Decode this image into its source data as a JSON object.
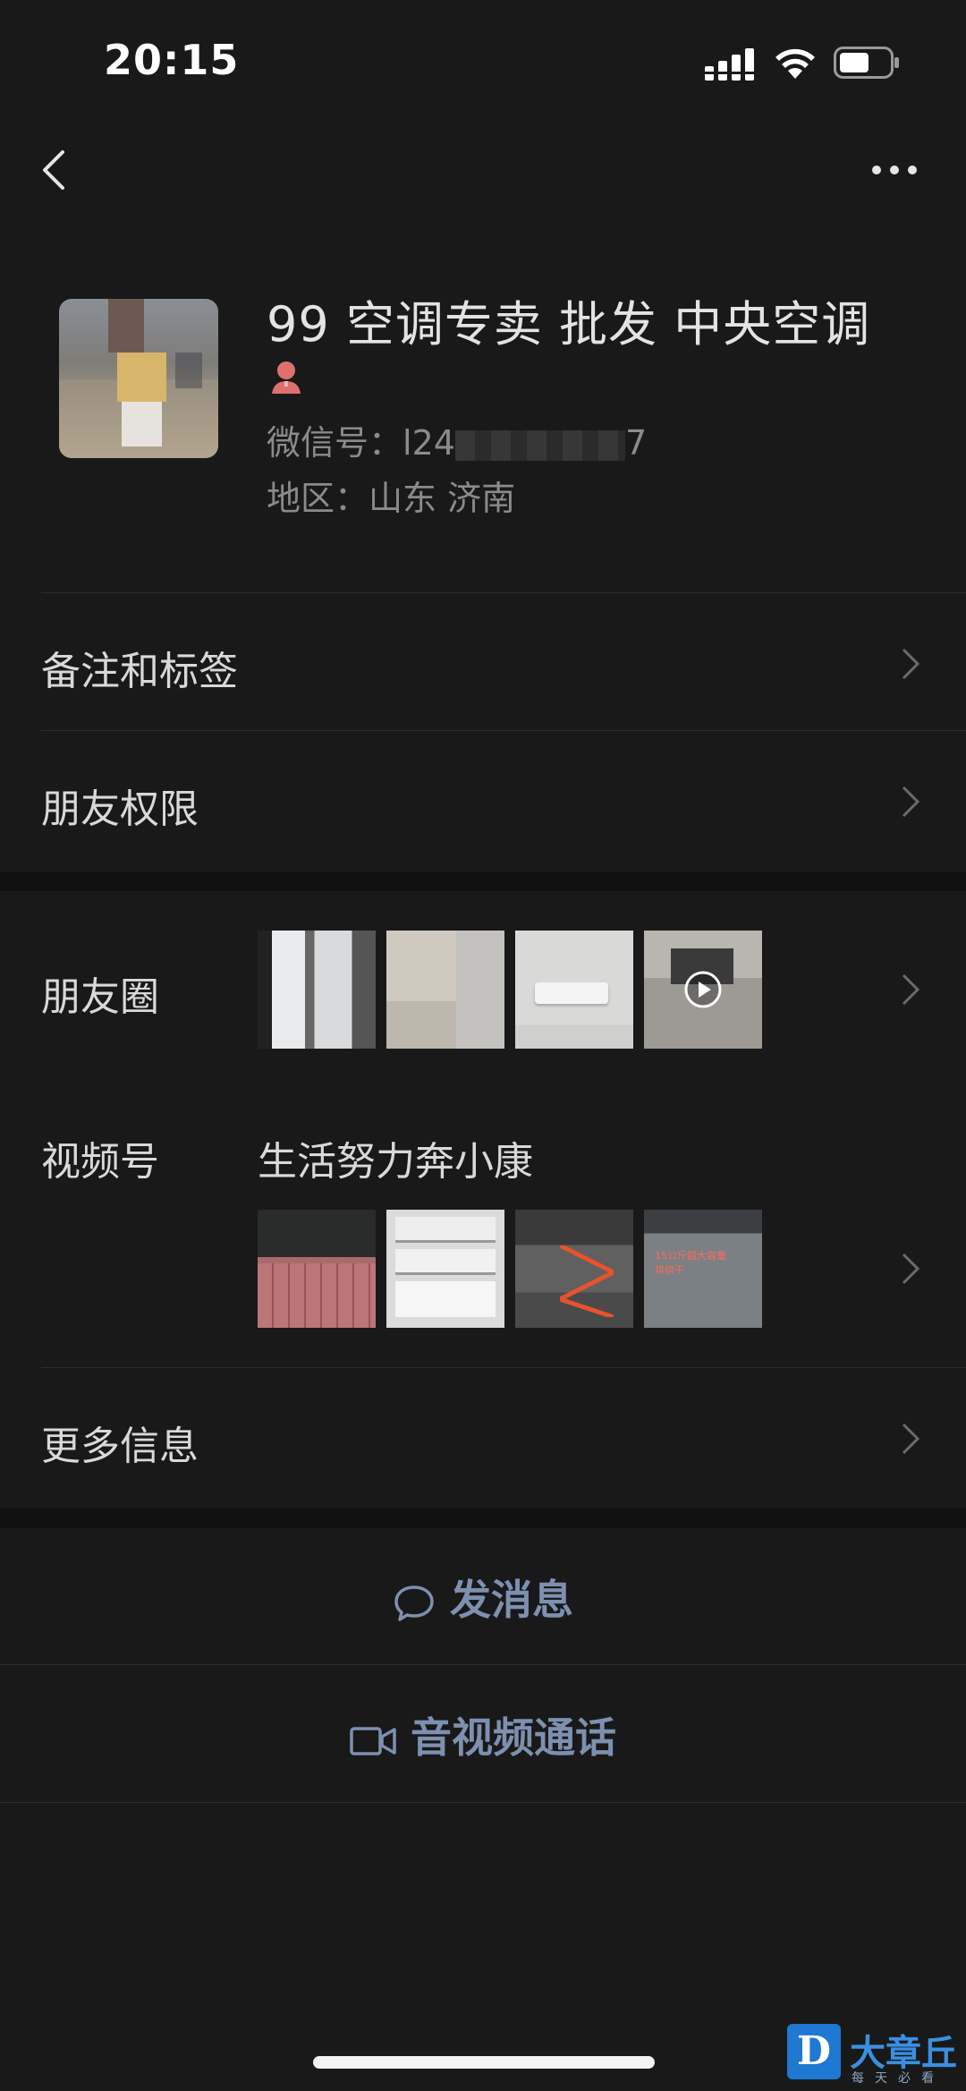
{
  "status_bar": {
    "time": "20:15"
  },
  "profile": {
    "name": "99 空调专卖  批发 中央空调",
    "wechat_id_label": "微信号：",
    "wechat_id_visible_start": "l24",
    "wechat_id_visible_end": "7",
    "region_label": "地区：",
    "region_value": "山东 济南",
    "gender_color": "#e06b6b"
  },
  "rows": {
    "remark_tags": "备注和标签",
    "friend_permissions": "朋友权限",
    "moments": "朋友圈",
    "channels": "视频号",
    "channel_name": "生活努力奔小康",
    "more_info": "更多信息"
  },
  "actions": {
    "send_message": "发消息",
    "av_call": "音视频通话"
  },
  "colors": {
    "background": "#191919",
    "action_text": "#7d90b0",
    "section_gap": "#111111"
  },
  "video_thumb_text": "15公斤超大容量\n烘烘干",
  "watermark": {
    "logo_letter": "D",
    "name": "大章丘",
    "slogan": "每天必看"
  },
  "icons": [
    "back-arrow-icon",
    "more-dots-icon",
    "female-icon",
    "play-icon",
    "chat-bubble-icon",
    "video-camera-icon",
    "chevron-right-icon"
  ]
}
